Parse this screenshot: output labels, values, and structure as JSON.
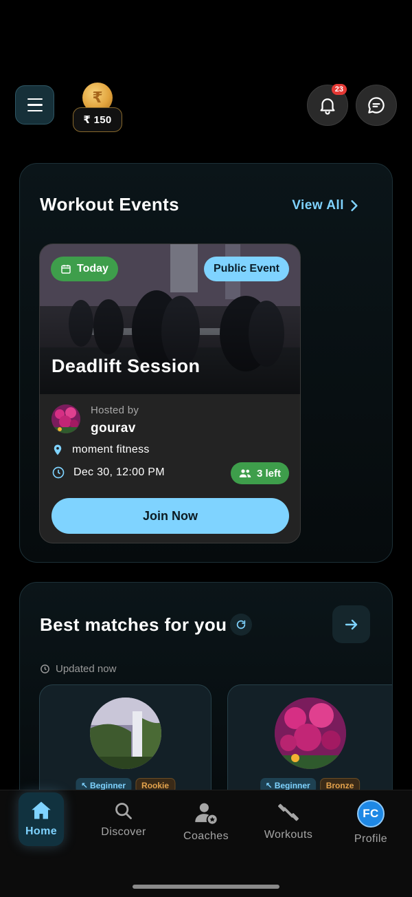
{
  "header": {
    "coin_symbol": "₹",
    "coin_balance": "₹ 150",
    "notifications_count": "23"
  },
  "events": {
    "title": "Workout Events",
    "view_all": "View All",
    "card": {
      "date_chip": "Today",
      "type_chip": "Public Event",
      "name": "Deadlift Session",
      "hosted_by_label": "Hosted by",
      "host": "gourav",
      "location": "moment fitness",
      "datetime": "Dec 30, 12:00 PM",
      "spots_left": "3 left",
      "join_label": "Join Now"
    }
  },
  "matches": {
    "title": "Best matches for you",
    "updated": "Updated now",
    "cards": [
      {
        "level": "Beginner",
        "rank": "Rookie"
      },
      {
        "level": "Beginner",
        "rank": "Bronze"
      }
    ]
  },
  "nav": {
    "items": [
      {
        "label": "Home",
        "icon": "home-icon"
      },
      {
        "label": "Discover",
        "icon": "search-icon"
      },
      {
        "label": "Coaches",
        "icon": "coach-icon"
      },
      {
        "label": "Workouts",
        "icon": "dumbbell-icon"
      },
      {
        "label": "Profile",
        "icon": "avatar"
      }
    ],
    "profile_initials": "FC"
  },
  "colors": {
    "accent": "#7fd3ff",
    "success": "#3e9e4b",
    "badge": "#e53935",
    "background": "#000000"
  }
}
